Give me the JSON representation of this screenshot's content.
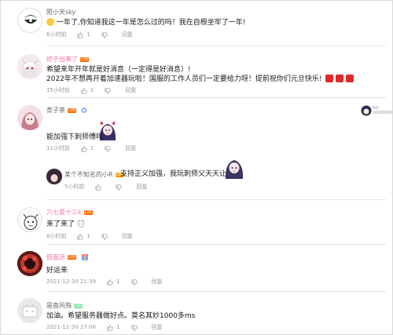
{
  "comments": [
    {
      "username": "陌小天sky",
      "text_prefix": "一年了,你知道我这一年是怎么过的吗！我在自根坐牢了一年!",
      "time": "6小时前",
      "likes": "1",
      "reply_label": "回复"
    },
    {
      "username": "终于出来了",
      "level": "LV6",
      "line1": "希望来年开年就是好消息（一定得是好消息）!",
      "line2": "2022年不想再开着加速器玩啦！国服的工作人员们一定要给力呀！提前祝你们元旦快乐!",
      "time": "15小时前",
      "likes": "1",
      "reply_label": "回复"
    },
    {
      "username": "柰子茶",
      "level": "LV6",
      "text": "能加强下刺师傅吗",
      "time": "11小时前",
      "likes": "1",
      "reply_label": "回复",
      "right_tag": "NO. 000000000",
      "reply": {
        "username": "某个不知名的小R",
        "level": "LV4",
        "text": "支持正义加强，我玩刺师父天天让人嫌",
        "time": "5小时前",
        "reply_label": "回复"
      }
    },
    {
      "username": "六七爱十三k",
      "level": "LV5",
      "text": "来了来了",
      "time": "8小时前",
      "likes": "1",
      "reply_label": "回复"
    },
    {
      "username": "假面凉",
      "level": "LV6",
      "text": "好运来",
      "time": "2021-12-30 21:39",
      "likes": "1",
      "reply_label": "回复"
    },
    {
      "username": "是南风殇",
      "level": "LV2",
      "text": "加油。希望服务器做好点。莫名其妙1000多ms",
      "time": "2021-12-30 17:06",
      "likes": "1",
      "reply_label": "回复"
    }
  ]
}
